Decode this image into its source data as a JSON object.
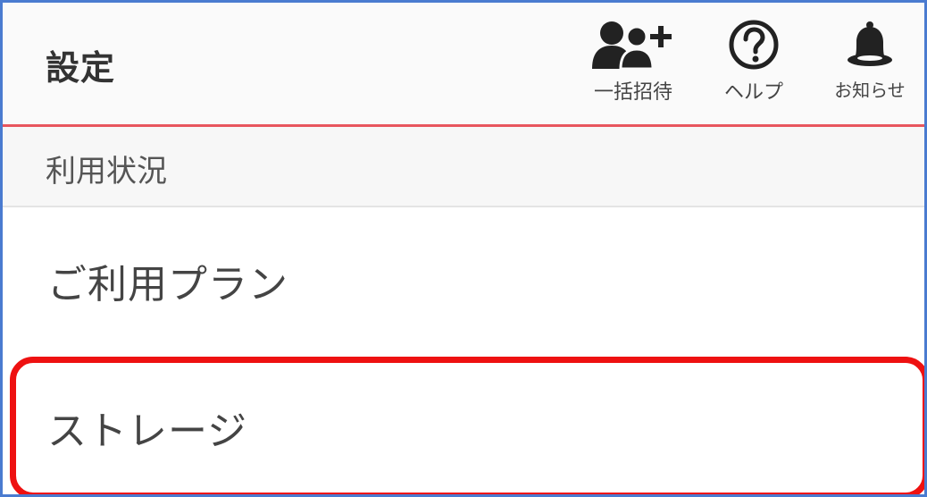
{
  "header": {
    "title": "設定",
    "actions": [
      {
        "icon": "bulk-invite-icon",
        "label": "一括招待"
      },
      {
        "icon": "help-icon",
        "label": "ヘルプ"
      },
      {
        "icon": "bell-icon",
        "label": "お知らせ"
      }
    ]
  },
  "section": {
    "label": "利用状況"
  },
  "menu": {
    "items": [
      {
        "label": "ご利用プラン"
      },
      {
        "label": "ストレージ"
      }
    ]
  },
  "colors": {
    "frame_border": "#4a7bd0",
    "header_accent": "#e8565e",
    "highlight": "#ee1111"
  }
}
